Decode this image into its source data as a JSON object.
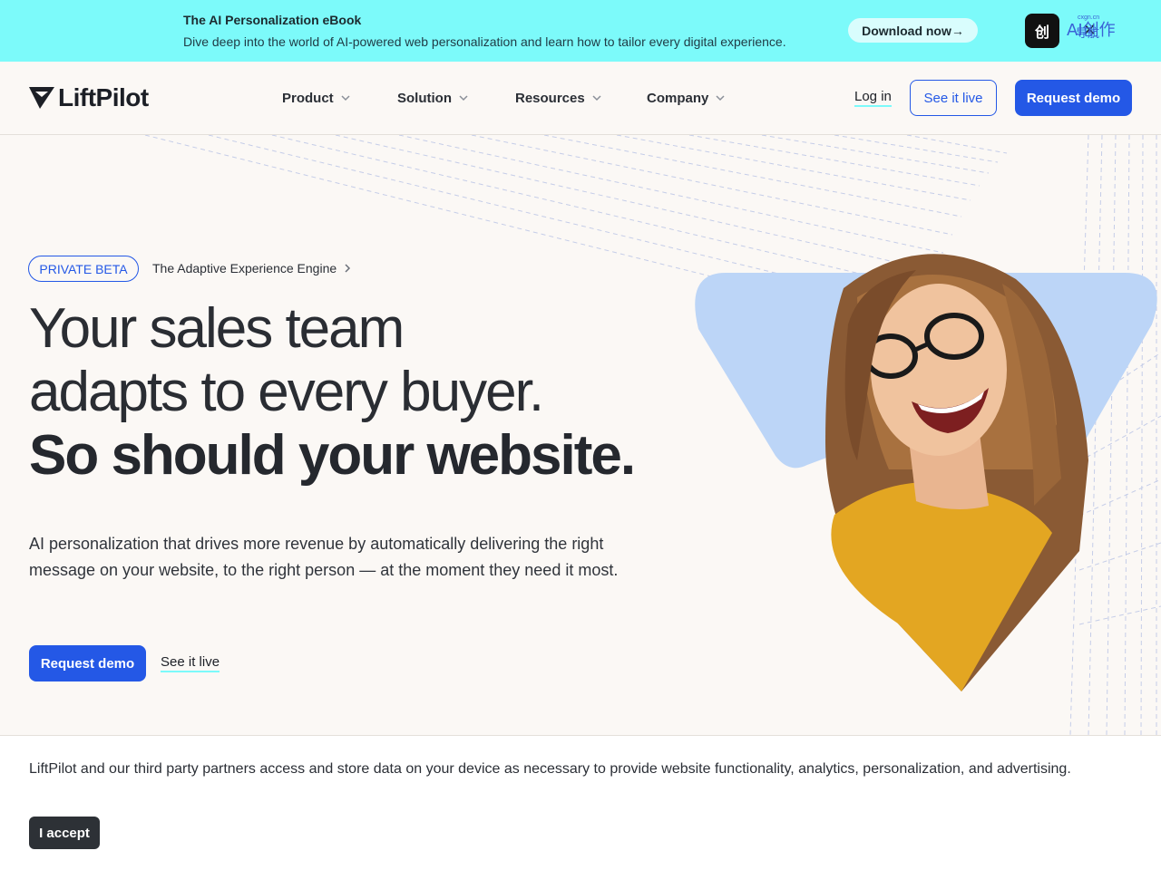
{
  "promo": {
    "title": "The AI Personalization eBook",
    "subtitle": "Dive deep into the world of AI-powered web personalization and learn how to tailor every digital experience.",
    "button_label": "Download now→",
    "close_icon": "close-icon",
    "background": "#7cfafa"
  },
  "badge": {
    "mark": "创",
    "text": "AI创作",
    "sub": "导航",
    "tiny": "cxgn.cn"
  },
  "nav": {
    "logo_text": "LiftPilot",
    "menu": [
      {
        "label": "Product"
      },
      {
        "label": "Solution"
      },
      {
        "label": "Resources"
      },
      {
        "label": "Company"
      }
    ],
    "login_label": "Log in",
    "see_live_label": "See it live",
    "request_demo_label": "Request demo"
  },
  "hero": {
    "pill_label": "PRIVATE BETA",
    "tagline": "The Adaptive Experience Engine",
    "heading_line1": "Your sales team",
    "heading_line2": "adapts to every buyer.",
    "heading_line3": "So should your website.",
    "lead": "AI personalization that drives more revenue by automatically delivering the right message on your website, to the right person — at the moment they need it most.",
    "primary_label": "Request demo",
    "secondary_label": "See it live",
    "image_alt_icon": "person-photo"
  },
  "cookie": {
    "text": "LiftPilot and our third party partners access and store data on your device as necessary to provide website functionality, analytics, personalization, and advertising.",
    "accept_label": "I accept"
  },
  "colors": {
    "accent": "#2458e6",
    "highlight": "#7cfafa",
    "page_bg": "#fbf8f5",
    "shape_blue": "#bcd5f7"
  }
}
